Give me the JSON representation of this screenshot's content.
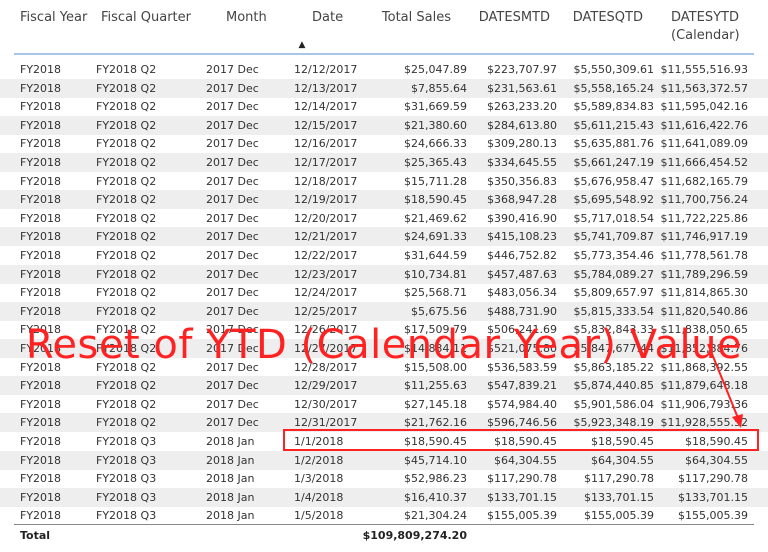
{
  "columns": [
    "Fiscal Year",
    "Fiscal Quarter",
    "Month",
    "Date",
    "Total Sales",
    "DATESMTD",
    "DATESQTD",
    "DATESYTD",
    "(Calendar)"
  ],
  "sort_icon": "sort-ascending-icon",
  "rows": [
    [
      "FY2018",
      "FY2018 Q2",
      "2017 Dec",
      "12/12/2017",
      "$25,047.89",
      "$223,707.97",
      "$5,550,309.61",
      "$11,555,516.93"
    ],
    [
      "FY2018",
      "FY2018 Q2",
      "2017 Dec",
      "12/13/2017",
      "$7,855.64",
      "$231,563.61",
      "$5,558,165.24",
      "$11,563,372.57"
    ],
    [
      "FY2018",
      "FY2018 Q2",
      "2017 Dec",
      "12/14/2017",
      "$31,669.59",
      "$263,233.20",
      "$5,589,834.83",
      "$11,595,042.16"
    ],
    [
      "FY2018",
      "FY2018 Q2",
      "2017 Dec",
      "12/15/2017",
      "$21,380.60",
      "$284,613.80",
      "$5,611,215.43",
      "$11,616,422.76"
    ],
    [
      "FY2018",
      "FY2018 Q2",
      "2017 Dec",
      "12/16/2017",
      "$24,666.33",
      "$309,280.13",
      "$5,635,881.76",
      "$11,641,089.09"
    ],
    [
      "FY2018",
      "FY2018 Q2",
      "2017 Dec",
      "12/17/2017",
      "$25,365.43",
      "$334,645.55",
      "$5,661,247.19",
      "$11,666,454.52"
    ],
    [
      "FY2018",
      "FY2018 Q2",
      "2017 Dec",
      "12/18/2017",
      "$15,711.28",
      "$350,356.83",
      "$5,676,958.47",
      "$11,682,165.79"
    ],
    [
      "FY2018",
      "FY2018 Q2",
      "2017 Dec",
      "12/19/2017",
      "$18,590.45",
      "$368,947.28",
      "$5,695,548.92",
      "$11,700,756.24"
    ],
    [
      "FY2018",
      "FY2018 Q2",
      "2017 Dec",
      "12/20/2017",
      "$21,469.62",
      "$390,416.90",
      "$5,717,018.54",
      "$11,722,225.86"
    ],
    [
      "FY2018",
      "FY2018 Q2",
      "2017 Dec",
      "12/21/2017",
      "$24,691.33",
      "$415,108.23",
      "$5,741,709.87",
      "$11,746,917.19"
    ],
    [
      "FY2018",
      "FY2018 Q2",
      "2017 Dec",
      "12/22/2017",
      "$31,644.59",
      "$446,752.82",
      "$5,773,354.46",
      "$11,778,561.78"
    ],
    [
      "FY2018",
      "FY2018 Q2",
      "2017 Dec",
      "12/23/2017",
      "$10,734.81",
      "$457,487.63",
      "$5,784,089.27",
      "$11,789,296.59"
    ],
    [
      "FY2018",
      "FY2018 Q2",
      "2017 Dec",
      "12/24/2017",
      "$25,568.71",
      "$483,056.34",
      "$5,809,657.97",
      "$11,814,865.30"
    ],
    [
      "FY2018",
      "FY2018 Q2",
      "2017 Dec",
      "12/25/2017",
      "$5,675.56",
      "$488,731.90",
      "$5,815,333.54",
      "$11,820,540.86"
    ],
    [
      "FY2018",
      "FY2018 Q2",
      "2017 Dec",
      "12/26/2017",
      "$17,509.79",
      "$506,241.69",
      "$5,832,843.33",
      "$11,838,050.65"
    ],
    [
      "FY2018",
      "FY2018 Q2",
      "2017 Dec",
      "12/27/2017",
      "$14,834.11",
      "$521,075.80",
      "$5,847,677.44",
      "$11,852,884.76"
    ],
    [
      "FY2018",
      "FY2018 Q2",
      "2017 Dec",
      "12/28/2017",
      "$15,508.00",
      "$536,583.59",
      "$5,863,185.22",
      "$11,868,392.55"
    ],
    [
      "FY2018",
      "FY2018 Q2",
      "2017 Dec",
      "12/29/2017",
      "$11,255.63",
      "$547,839.21",
      "$5,874,440.85",
      "$11,879,648.18"
    ],
    [
      "FY2018",
      "FY2018 Q2",
      "2017 Dec",
      "12/30/2017",
      "$27,145.18",
      "$574,984.40",
      "$5,901,586.04",
      "$11,906,793.36"
    ],
    [
      "FY2018",
      "FY2018 Q2",
      "2017 Dec",
      "12/31/2017",
      "$21,762.16",
      "$596,746.56",
      "$5,923,348.19",
      "$11,928,555.52"
    ],
    [
      "FY2018",
      "FY2018 Q3",
      "2018 Jan",
      "1/1/2018",
      "$18,590.45",
      "$18,590.45",
      "$18,590.45",
      "$18,590.45"
    ],
    [
      "FY2018",
      "FY2018 Q3",
      "2018 Jan",
      "1/2/2018",
      "$45,714.10",
      "$64,304.55",
      "$64,304.55",
      "$64,304.55"
    ],
    [
      "FY2018",
      "FY2018 Q3",
      "2018 Jan",
      "1/3/2018",
      "$52,986.23",
      "$117,290.78",
      "$117,290.78",
      "$117,290.78"
    ],
    [
      "FY2018",
      "FY2018 Q3",
      "2018 Jan",
      "1/4/2018",
      "$16,410.37",
      "$133,701.15",
      "$133,701.15",
      "$133,701.15"
    ],
    [
      "FY2018",
      "FY2018 Q3",
      "2018 Jan",
      "1/5/2018",
      "$21,304.24",
      "$155,005.39",
      "$155,005.39",
      "$155,005.39"
    ]
  ],
  "total": {
    "label": "Total",
    "sales": "$109,809,274.20"
  },
  "annotation": {
    "text": "Reset of YTD (Calendar Year) Value",
    "color": "#ff2222"
  }
}
